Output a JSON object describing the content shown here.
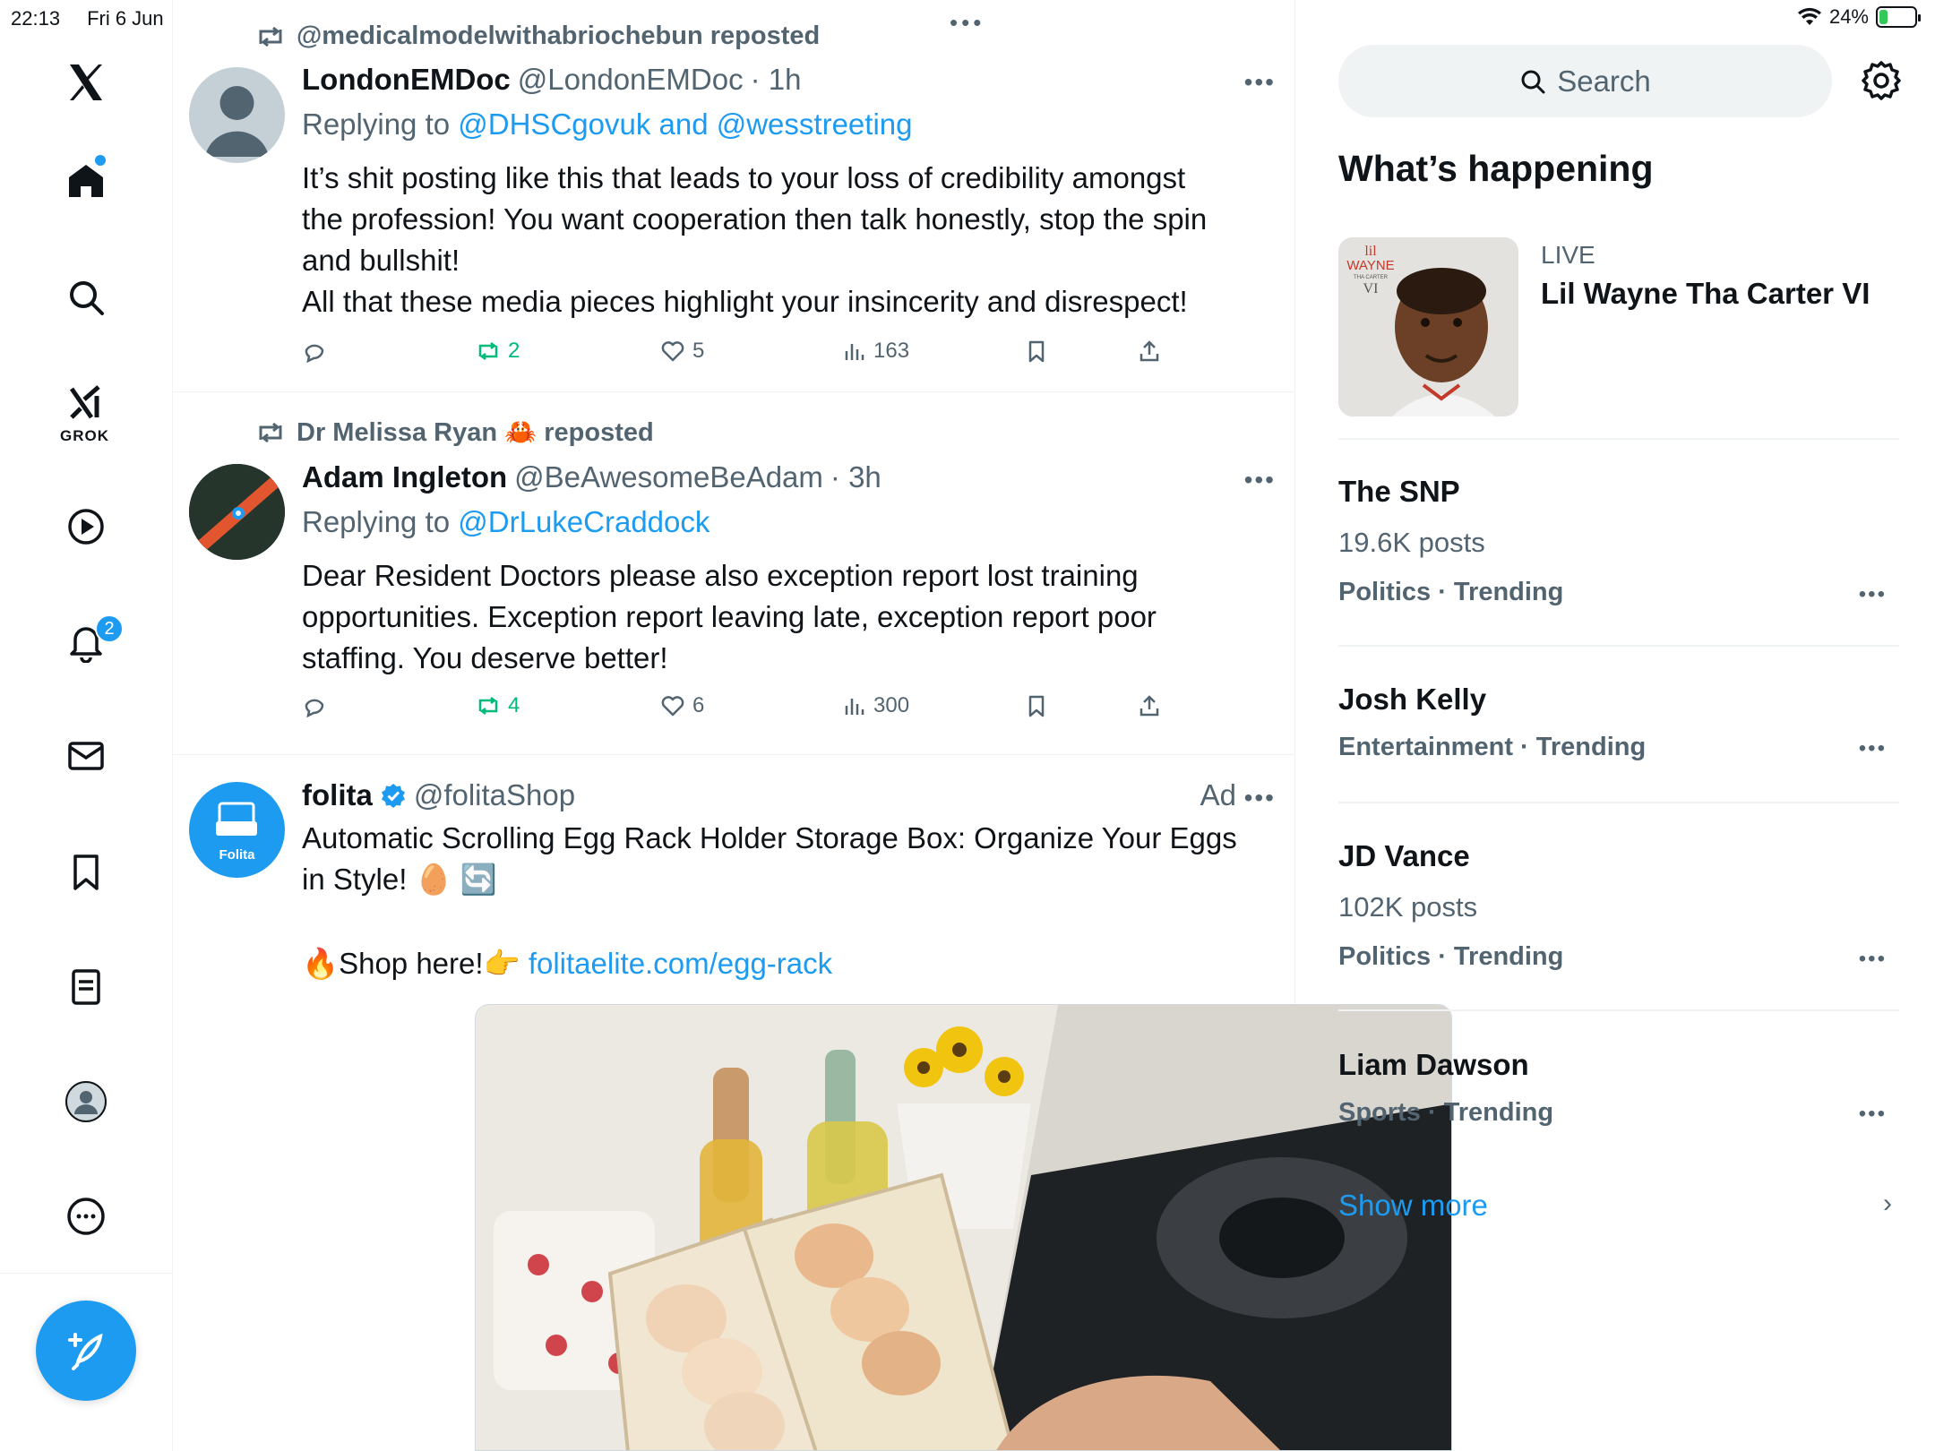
{
  "status_bar": {
    "time": "22:13",
    "date": "Fri 6 Jun",
    "dots": "•••",
    "battery": "24%",
    "battery_level": 0.24
  },
  "nav": {
    "items": [
      "x-logo",
      "home",
      "explore",
      "grok",
      "video",
      "notifications",
      "messages",
      "bookmarks",
      "lists",
      "profile",
      "more"
    ],
    "grok_label": "GROK",
    "notification_count": "2"
  },
  "feed": {
    "posts": [
      {
        "repost_by": "@medicalmodelwithabriochebun reposted",
        "name": "LondonEMDoc",
        "handle": "@LondonEMDoc",
        "time": "· 1h",
        "replying_prefix": "Replying to ",
        "replying_mentions": "@DHSCgovuk and @wesstreeting",
        "text_lines": [
          "It’s shit posting like this that leads to your loss of credibility amongst",
          "the profession! You want cooperation then talk honestly, stop the spin",
          "and bullshit!",
          "All that these media pieces highlight your insincerity and disrespect!"
        ],
        "reposts": "2",
        "likes": "5",
        "views": "163"
      },
      {
        "repost_by": "Dr Melissa Ryan 🦀 reposted",
        "name": "Adam Ingleton",
        "handle": "@BeAwesomeBeAdam",
        "time": "· 3h",
        "replying_prefix": "Replying to ",
        "replying_mentions": "@DrLukeCraddock",
        "text_lines": [
          "Dear Resident Doctors please also exception report lost training",
          "opportunities. Exception report leaving late, exception report poor",
          "staffing. You deserve better!"
        ],
        "reposts": "4",
        "likes": "6",
        "views": "300"
      }
    ],
    "ad": {
      "name": "folita",
      "handle": "@folitaShop",
      "ad_label": "Ad",
      "avatar_text": "Folita",
      "text_line1": "Automatic Scrolling Egg Rack Holder Storage Box: Organize Your Eggs",
      "text_line2": "in Style! 🥚 🔄",
      "shop_prefix": "🔥Shop here!👉 ",
      "link": "folitaelite.com/egg-rack"
    }
  },
  "sidebar": {
    "search_placeholder": "Search",
    "section_title": "What’s happening",
    "live": {
      "tag": "LIVE",
      "title": "Lil Wayne Tha Carter VI",
      "thumb_text_1": "lil",
      "thumb_text_2": "WAYNE",
      "thumb_text_3": "THA CARTER",
      "thumb_text_4": "VI"
    },
    "trends": [
      {
        "name": "The SNP",
        "posts": "19.6K posts",
        "category": "Politics · Trending"
      },
      {
        "name": "Josh Kelly",
        "posts": "",
        "category": "Entertainment · Trending"
      },
      {
        "name": "JD Vance",
        "posts": "102K posts",
        "category": "Politics · Trending"
      },
      {
        "name": "Liam Dawson",
        "posts": "",
        "category": "Sports · Trending"
      }
    ],
    "show_more": "Show more"
  },
  "colors": {
    "accent": "#1d9bf0",
    "repost_green": "#00ba7c",
    "muted": "#536471",
    "text": "#0f1419"
  }
}
